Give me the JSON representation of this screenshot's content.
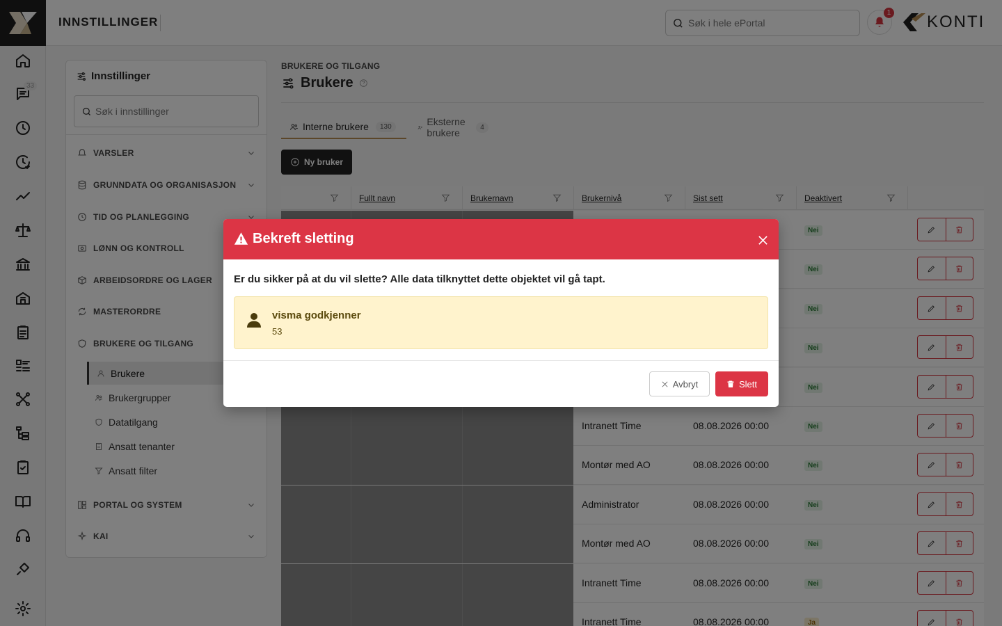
{
  "topbar": {
    "title": "INNSTILLINGER",
    "search_placeholder": "Søk i hele ePortal",
    "notification_count": "1",
    "brand": "KONTI"
  },
  "rail": {
    "messages_badge": "33",
    "icons": [
      "home-icon",
      "messages-icon",
      "clock-icon",
      "time-history-icon",
      "trend-icon",
      "scale-icon",
      "bank-icon",
      "building-icon",
      "clipboard-icon",
      "list-icon",
      "network-icon",
      "hierarchy-icon",
      "checklist-icon",
      "book-icon",
      "headset-icon",
      "plug-icon",
      "settings-icon"
    ]
  },
  "settings_panel": {
    "title": "Innstillinger",
    "search_placeholder": "Søk i innstillinger",
    "sections": [
      {
        "label": "VARSLER"
      },
      {
        "label": "GRUNNDATA OG ORGANISASJON"
      },
      {
        "label": "TID OG PLANLEGGING"
      },
      {
        "label": "LØNN OG KONTROLL"
      },
      {
        "label": "ARBEIDSORDRE OG LAGER"
      },
      {
        "label": "MASTERORDRE"
      },
      {
        "label": "BRUKERE OG TILGANG"
      },
      {
        "label": "PORTAL OG SYSTEM"
      },
      {
        "label": "KAI"
      }
    ],
    "subitems": [
      {
        "label": "Brukere",
        "active": true
      },
      {
        "label": "Brukergrupper"
      },
      {
        "label": "Datatilgang"
      },
      {
        "label": "Ansatt tenanter"
      },
      {
        "label": "Ansatt filter"
      }
    ]
  },
  "main": {
    "breadcrumb": "BRUKERE OG TILGANG",
    "page_title": "Brukere",
    "tabs": [
      {
        "label": "Interne brukere",
        "count": "130",
        "active": true
      },
      {
        "label": "Eksterne brukere",
        "count": "4"
      }
    ],
    "new_button": "Ny bruker",
    "columns": [
      "Fullt navn",
      "Brukernavn",
      "Brukernivå",
      "Sist sett",
      "Deaktivert"
    ],
    "rows": [
      {
        "level": "",
        "seen": "",
        "deactivated": "Nei"
      },
      {
        "level": "",
        "seen": "",
        "deactivated": "Nei"
      },
      {
        "level": "",
        "seen": "",
        "deactivated": "Nei"
      },
      {
        "level": "",
        "seen": "",
        "deactivated": "Nei"
      },
      {
        "level": "",
        "seen": "",
        "deactivated": "Nei"
      },
      {
        "level": "Intranett Time",
        "seen": "08.08.2026 00:00",
        "deactivated": "Nei"
      },
      {
        "level": "Montør med AO",
        "seen": "08.08.2026 00:00",
        "deactivated": "Nei"
      },
      {
        "level": "Administrator",
        "seen": "08.08.2026 00:00",
        "deactivated": "Nei"
      },
      {
        "level": "Montør med AO",
        "seen": "08.08.2026 00:00",
        "deactivated": "Nei"
      },
      {
        "level": "Intranett Time",
        "seen": "08.08.2026 00:00",
        "deactivated": "Nei"
      },
      {
        "level": "Intranett Time",
        "seen": "08.08.2026 00:00",
        "deactivated": "Ja"
      }
    ]
  },
  "modal": {
    "title": "Bekreft sletting",
    "question": "Er du sikker på at du vil slette? Alle data tilknyttet dette objektet vil gå tapt.",
    "item_name": "visma godkjenner",
    "item_id": "53",
    "cancel_label": "Avbryt",
    "delete_label": "Slett"
  },
  "colors": {
    "danger": "#dc3545",
    "dark": "#222222",
    "accent": "#b78d52",
    "warning_bg": "#fff3cd"
  }
}
